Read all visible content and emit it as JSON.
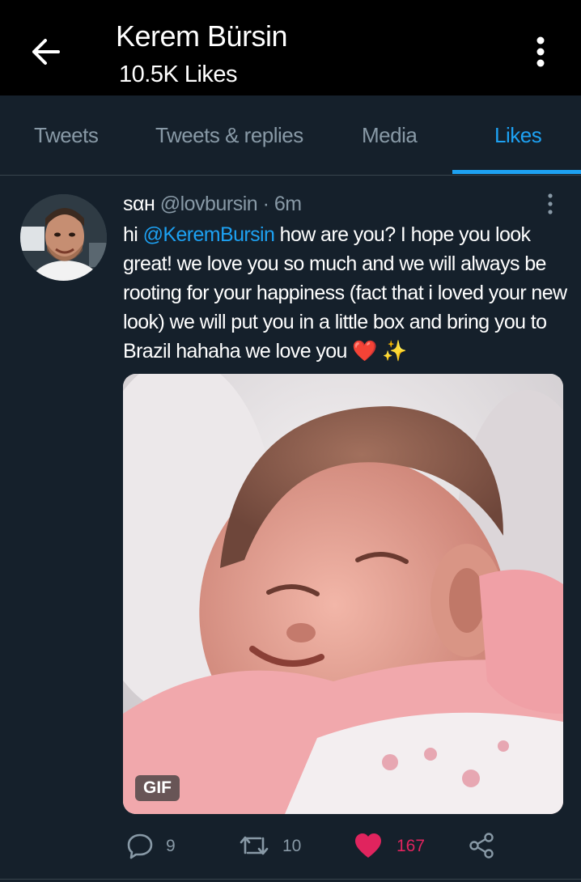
{
  "header": {
    "title": "Kerem Bürsin",
    "subtitle": "10.5K Likes"
  },
  "tabs": [
    {
      "label": "Tweets",
      "active": false
    },
    {
      "label": "Tweets & replies",
      "active": false
    },
    {
      "label": "Media",
      "active": false
    },
    {
      "label": "Likes",
      "active": true
    }
  ],
  "tweet": {
    "author_name": "sαн",
    "handle": "@lovbursin",
    "time": "· 6m",
    "text_before": "hi ",
    "mention": "@KeremBursin",
    "text_after": " how are you? I hope you look great! we love you so much and we will always be rooting for your happiness (fact that i loved your new look) we will put you in a little box and bring you to Brazil hahaha we love you ",
    "emoji": "❤️ ✨",
    "media_badge": "GIF",
    "stats": {
      "replies": "9",
      "retweets": "10",
      "likes": "167"
    }
  },
  "colors": {
    "background": "#15202b",
    "accent": "#1da1f2",
    "like": "#e0245e",
    "muted": "#8899a6"
  },
  "icons": [
    "back-arrow-icon",
    "more-vertical-icon",
    "reply-icon",
    "retweet-icon",
    "heart-icon",
    "share-icon"
  ]
}
